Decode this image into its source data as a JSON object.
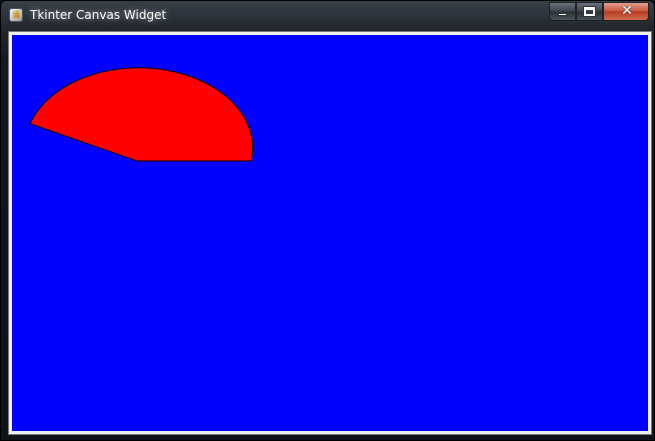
{
  "window": {
    "title": "Tkinter Canvas Widget",
    "icon": "python-tk-app-icon"
  },
  "controls": {
    "minimize_icon": "minimize-icon",
    "maximize_icon": "maximize-icon",
    "close_icon": "close-icon",
    "close_glyph": "✕"
  },
  "canvas": {
    "background": "#0000ff",
    "shapes": [
      {
        "type": "arc",
        "style": "pieslice",
        "fill": "#ff0000",
        "outline": "#000000",
        "start_deg": 0,
        "extent_deg": 160
      }
    ]
  }
}
